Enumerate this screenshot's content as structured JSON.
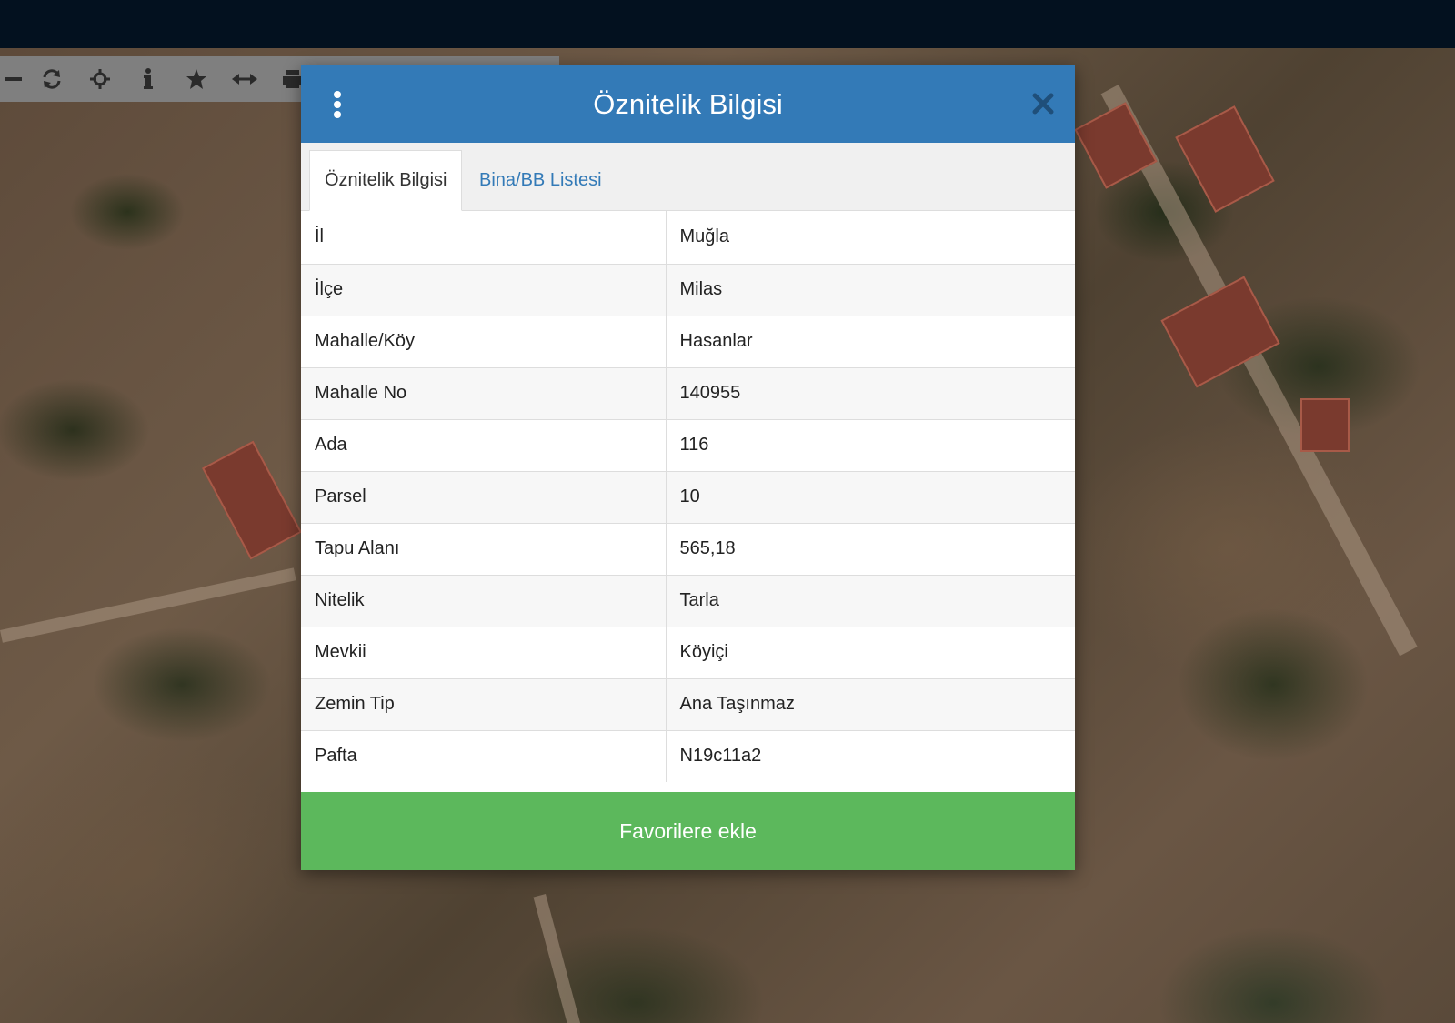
{
  "toolbar": {
    "tools": [
      {
        "icon": "minus-icon"
      },
      {
        "icon": "refresh-icon"
      },
      {
        "icon": "crosshair-icon"
      },
      {
        "icon": "info-icon"
      },
      {
        "icon": "star-icon"
      },
      {
        "icon": "measure-arrows-icon"
      },
      {
        "icon": "print-icon"
      }
    ]
  },
  "modal": {
    "title": "Öznitelik Bilgisi",
    "menu_icon": "vertical-dots-icon",
    "close_icon": "close-icon",
    "header_color": "#337ab7",
    "tabs": [
      {
        "label": "Öznitelik Bilgisi",
        "active": true
      },
      {
        "label": "Bina/BB Listesi",
        "active": false
      }
    ],
    "rows": [
      {
        "key": "İl",
        "value": "Muğla"
      },
      {
        "key": "İlçe",
        "value": "Milas"
      },
      {
        "key": "Mahalle/Köy",
        "value": "Hasanlar"
      },
      {
        "key": "Mahalle No",
        "value": "140955"
      },
      {
        "key": "Ada",
        "value": "116"
      },
      {
        "key": "Parsel",
        "value": "10"
      },
      {
        "key": "Tapu Alanı",
        "value": "565,18"
      },
      {
        "key": "Nitelik",
        "value": "Tarla"
      },
      {
        "key": "Mevkii",
        "value": "Köyiçi"
      },
      {
        "key": "Zemin Tip",
        "value": "Ana Taşınmaz"
      },
      {
        "key": "Pafta",
        "value": "N19c11a2"
      }
    ],
    "favorite_button": "Favorilere ekle",
    "favorite_color": "#5cb85c"
  }
}
